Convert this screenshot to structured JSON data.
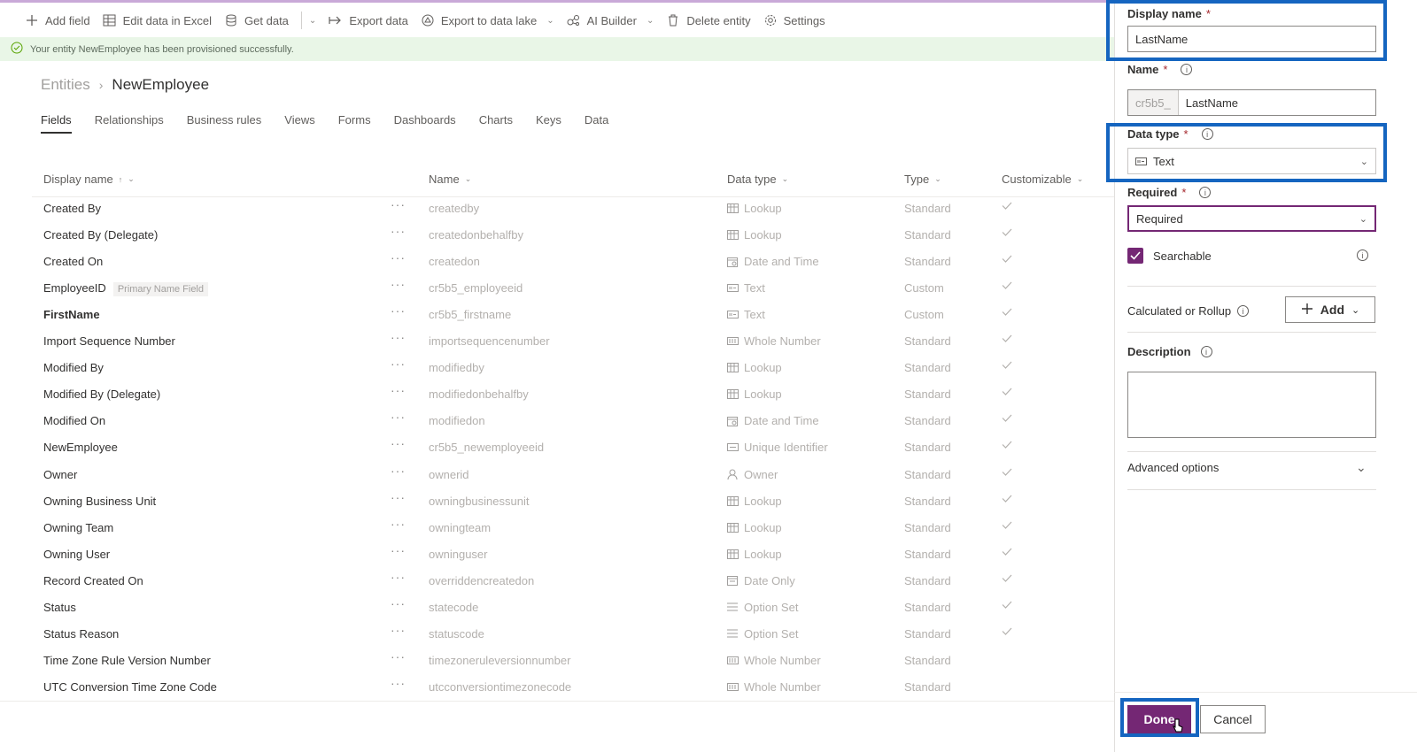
{
  "toolbar": {
    "items": [
      {
        "label": "Add field",
        "icon": "plus-icon"
      },
      {
        "label": "Edit data in Excel",
        "icon": "excel-icon"
      },
      {
        "label": "Get data",
        "icon": "database-icon"
      },
      {
        "label": "Export data",
        "icon": "export-icon"
      },
      {
        "label": "Export to data lake",
        "icon": "data-lake-icon"
      },
      {
        "label": "AI Builder",
        "icon": "ai-builder-icon"
      },
      {
        "label": "Delete entity",
        "icon": "trash-icon"
      },
      {
        "label": "Settings",
        "icon": "gear-icon"
      }
    ]
  },
  "notification": {
    "text": "Your entity NewEmployee has been provisioned successfully."
  },
  "breadcrumb": {
    "root": "Entities",
    "current": "NewEmployee"
  },
  "tabs": [
    "Fields",
    "Relationships",
    "Business rules",
    "Views",
    "Forms",
    "Dashboards",
    "Charts",
    "Keys",
    "Data"
  ],
  "table": {
    "columns": {
      "display_name": "Display name",
      "name": "Name",
      "data_type": "Data type",
      "type": "Type",
      "customizable": "Customizable"
    },
    "primary_badge": "Primary Name Field",
    "rows": [
      {
        "display": "Created By",
        "name": "createdby",
        "dtype": "Lookup",
        "type": "Standard",
        "check": true
      },
      {
        "display": "Created By (Delegate)",
        "name": "createdonbehalfby",
        "dtype": "Lookup",
        "type": "Standard",
        "check": true
      },
      {
        "display": "Created On",
        "name": "createdon",
        "dtype": "Date and Time",
        "type": "Standard",
        "check": true
      },
      {
        "display": "EmployeeID",
        "name": "cr5b5_employeeid",
        "dtype": "Text",
        "type": "Custom",
        "check": true,
        "primary": true
      },
      {
        "display": "FirstName",
        "name": "cr5b5_firstname",
        "dtype": "Text",
        "type": "Custom",
        "check": true,
        "bold": true
      },
      {
        "display": "Import Sequence Number",
        "name": "importsequencenumber",
        "dtype": "Whole Number",
        "type": "Standard",
        "check": true
      },
      {
        "display": "Modified By",
        "name": "modifiedby",
        "dtype": "Lookup",
        "type": "Standard",
        "check": true
      },
      {
        "display": "Modified By (Delegate)",
        "name": "modifiedonbehalfby",
        "dtype": "Lookup",
        "type": "Standard",
        "check": true
      },
      {
        "display": "Modified On",
        "name": "modifiedon",
        "dtype": "Date and Time",
        "type": "Standard",
        "check": true
      },
      {
        "display": "NewEmployee",
        "name": "cr5b5_newemployeeid",
        "dtype": "Unique Identifier",
        "type": "Standard",
        "check": true
      },
      {
        "display": "Owner",
        "name": "ownerid",
        "dtype": "Owner",
        "type": "Standard",
        "check": true
      },
      {
        "display": "Owning Business Unit",
        "name": "owningbusinessunit",
        "dtype": "Lookup",
        "type": "Standard",
        "check": true
      },
      {
        "display": "Owning Team",
        "name": "owningteam",
        "dtype": "Lookup",
        "type": "Standard",
        "check": true
      },
      {
        "display": "Owning User",
        "name": "owninguser",
        "dtype": "Lookup",
        "type": "Standard",
        "check": true
      },
      {
        "display": "Record Created On",
        "name": "overriddencreatedon",
        "dtype": "Date Only",
        "type": "Standard",
        "check": true
      },
      {
        "display": "Status",
        "name": "statecode",
        "dtype": "Option Set",
        "type": "Standard",
        "check": true
      },
      {
        "display": "Status Reason",
        "name": "statuscode",
        "dtype": "Option Set",
        "type": "Standard",
        "check": true
      },
      {
        "display": "Time Zone Rule Version Number",
        "name": "timezoneruleversionnumber",
        "dtype": "Whole Number",
        "type": "Standard",
        "check": false
      },
      {
        "display": "UTC Conversion Time Zone Code",
        "name": "utcconversiontimezonecode",
        "dtype": "Whole Number",
        "type": "Standard",
        "check": false
      }
    ]
  },
  "panel": {
    "display_name_label": "Display name",
    "display_name_value": "LastName",
    "name_label": "Name",
    "name_prefix": "cr5b5_",
    "name_value": "LastName",
    "data_type_label": "Data type",
    "data_type_value": "Text",
    "required_label": "Required",
    "required_value": "Required",
    "searchable_label": "Searchable",
    "calc_label": "Calculated or Rollup",
    "add_label": "Add",
    "description_label": "Description",
    "advanced_label": "Advanced options",
    "done_label": "Done",
    "cancel_label": "Cancel",
    "required_marker": "*"
  },
  "colors": {
    "accent": "#742774",
    "highlight": "#1565c0",
    "notification_bg": "#e9f6e7"
  }
}
